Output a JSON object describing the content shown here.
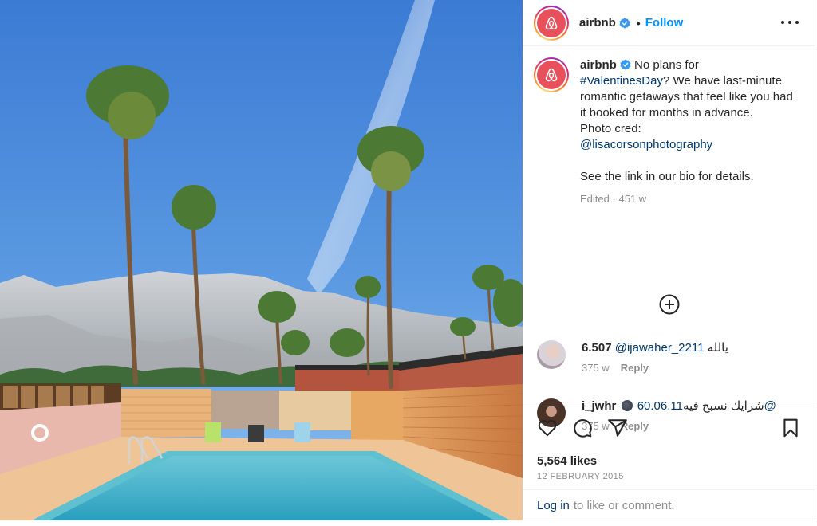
{
  "photo": {
    "alt": "Palm Springs motel pool with palm trees and mountains under a blue sky"
  },
  "header": {
    "username": "airbnb",
    "verified": true,
    "separator": "•",
    "follow_label": "Follow",
    "more_icon": "more-horizontal-icon"
  },
  "caption": {
    "username": "airbnb",
    "text_part1": " No plans for ",
    "hashtag": "#ValentinesDay",
    "text_part2": "? We have last-minute romantic getaways that feel like you had it booked for months in advance.",
    "photo_cred_label": "Photo cred:",
    "mention": "@lisacorsonphotography",
    "text_part3": "See the link in our bio for details.",
    "edited_label": "Edited",
    "meta_separator": "·",
    "age": "451 w"
  },
  "load_more_icon": "plus-circle-icon",
  "comments": [
    {
      "username": "6.507",
      "mention": "@ijawaher_2211",
      "text": " يالله",
      "age": "375 w",
      "reply_label": "Reply"
    },
    {
      "username": "i_jwhr",
      "emoji": "new-moon-face",
      "text": " شرايك نسبح فيه",
      "mention": "60.06.11@",
      "age": "375 w",
      "reply_label": "Reply"
    }
  ],
  "actions": {
    "like_icon": "heart-icon",
    "comment_icon": "comment-icon",
    "share_icon": "send-icon",
    "save_icon": "bookmark-icon",
    "likes": "5,564 likes",
    "date": "12 FEBRUARY 2015"
  },
  "footer": {
    "login_label": "Log in",
    "login_suffix": "to like or comment."
  },
  "colors": {
    "brand": "#e8505b",
    "link": "#00376b",
    "follow": "#0095f6",
    "muted": "#8e8e8e"
  }
}
